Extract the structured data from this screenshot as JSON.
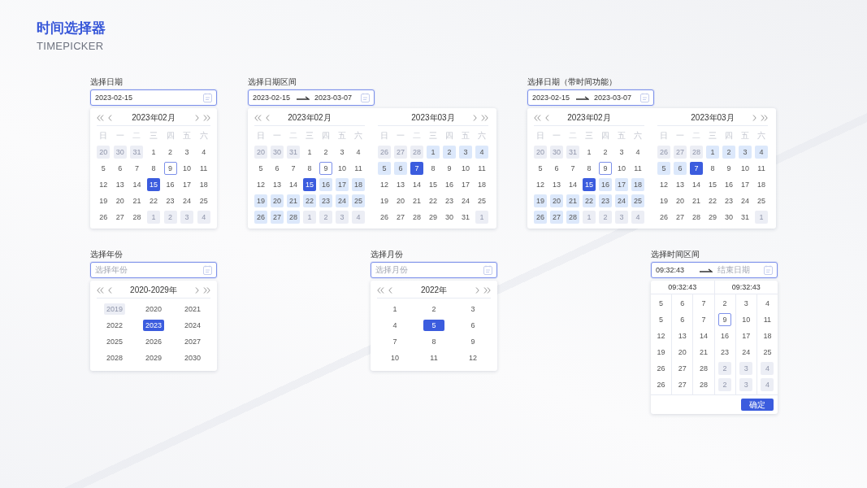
{
  "header": {
    "title": "时间选择器",
    "subtitle": "TIMEPICKER"
  },
  "pickers": [
    {
      "kind": "date",
      "label": "选择日期",
      "input": {
        "value": "2023-02-15"
      },
      "months": [
        {
          "title": "2023年02月",
          "weekdays": [
            "日",
            "一",
            "二",
            "三",
            "四",
            "五",
            "六"
          ],
          "days": [
            {
              "text": "20",
              "kind": "outside",
              "selected": false
            },
            {
              "text": "30",
              "kind": "outside",
              "selected": false
            },
            {
              "text": "31",
              "kind": "outside",
              "selected": false
            },
            {
              "text": "1",
              "kind": "day",
              "selected": false
            },
            {
              "text": "2",
              "kind": "day",
              "selected": false
            },
            {
              "text": "3",
              "kind": "day",
              "selected": false
            },
            {
              "text": "4",
              "kind": "day",
              "selected": false
            },
            {
              "text": "5",
              "kind": "day",
              "selected": false
            },
            {
              "text": "6",
              "kind": "day",
              "selected": false
            },
            {
              "text": "7",
              "kind": "day",
              "selected": false
            },
            {
              "text": "8",
              "kind": "day",
              "selected": false
            },
            {
              "text": "9",
              "kind": "today",
              "selected": false
            },
            {
              "text": "10",
              "kind": "day",
              "selected": false
            },
            {
              "text": "11",
              "kind": "day",
              "selected": false
            },
            {
              "text": "12",
              "kind": "day",
              "selected": false
            },
            {
              "text": "13",
              "kind": "day",
              "selected": false
            },
            {
              "text": "14",
              "kind": "day",
              "selected": false
            },
            {
              "text": "15",
              "kind": "day",
              "selected": true
            },
            {
              "text": "16",
              "kind": "day",
              "selected": false
            },
            {
              "text": "17",
              "kind": "day",
              "selected": false
            },
            {
              "text": "18",
              "kind": "day",
              "selected": false
            },
            {
              "text": "19",
              "kind": "day",
              "selected": false
            },
            {
              "text": "20",
              "kind": "day",
              "selected": false
            },
            {
              "text": "21",
              "kind": "day",
              "selected": false
            },
            {
              "text": "22",
              "kind": "day",
              "selected": false
            },
            {
              "text": "23",
              "kind": "day",
              "selected": false
            },
            {
              "text": "24",
              "kind": "day",
              "selected": false
            },
            {
              "text": "25",
              "kind": "day",
              "selected": false
            },
            {
              "text": "26",
              "kind": "day",
              "selected": false
            },
            {
              "text": "27",
              "kind": "day",
              "selected": false
            },
            {
              "text": "28",
              "kind": "day",
              "selected": false
            },
            {
              "text": "1",
              "kind": "outside",
              "selected": false
            },
            {
              "text": "2",
              "kind": "outside",
              "selected": false
            },
            {
              "text": "3",
              "kind": "outside",
              "selected": false
            },
            {
              "text": "4",
              "kind": "outside",
              "selected": false
            }
          ]
        }
      ]
    },
    {
      "kind": "date_range",
      "label": "选择日期区间",
      "input": {
        "start": "2023-02-15",
        "end": "2023-03-07"
      },
      "months": [
        {
          "title": "2023年02月",
          "weekdays": [
            "日",
            "一",
            "二",
            "三",
            "四",
            "五",
            "六"
          ],
          "days": [
            {
              "text": "20",
              "kind": "outside",
              "selected": false
            },
            {
              "text": "30",
              "kind": "outside",
              "selected": false
            },
            {
              "text": "31",
              "kind": "outside",
              "selected": false
            },
            {
              "text": "1",
              "kind": "day",
              "selected": false
            },
            {
              "text": "2",
              "kind": "day",
              "selected": false
            },
            {
              "text": "3",
              "kind": "day",
              "selected": false
            },
            {
              "text": "4",
              "kind": "day",
              "selected": false
            },
            {
              "text": "5",
              "kind": "day",
              "selected": false
            },
            {
              "text": "6",
              "kind": "day",
              "selected": false
            },
            {
              "text": "7",
              "kind": "day",
              "selected": false
            },
            {
              "text": "8",
              "kind": "day",
              "selected": false
            },
            {
              "text": "9",
              "kind": "today",
              "selected": false
            },
            {
              "text": "10",
              "kind": "day",
              "selected": false
            },
            {
              "text": "11",
              "kind": "day",
              "selected": false
            },
            {
              "text": "12",
              "kind": "day",
              "selected": false
            },
            {
              "text": "13",
              "kind": "day",
              "selected": false
            },
            {
              "text": "14",
              "kind": "day",
              "selected": false
            },
            {
              "text": "15",
              "kind": "day",
              "selected": true
            },
            {
              "text": "16",
              "kind": "range",
              "selected": false
            },
            {
              "text": "17",
              "kind": "range",
              "selected": false
            },
            {
              "text": "18",
              "kind": "range",
              "selected": false
            },
            {
              "text": "19",
              "kind": "range",
              "selected": false
            },
            {
              "text": "20",
              "kind": "range",
              "selected": false
            },
            {
              "text": "21",
              "kind": "range",
              "selected": false
            },
            {
              "text": "22",
              "kind": "range",
              "selected": false
            },
            {
              "text": "23",
              "kind": "range",
              "selected": false
            },
            {
              "text": "24",
              "kind": "range",
              "selected": false
            },
            {
              "text": "25",
              "kind": "range",
              "selected": false
            },
            {
              "text": "26",
              "kind": "range",
              "selected": false
            },
            {
              "text": "27",
              "kind": "range",
              "selected": false
            },
            {
              "text": "28",
              "kind": "range",
              "selected": false
            },
            {
              "text": "1",
              "kind": "outside",
              "selected": false
            },
            {
              "text": "2",
              "kind": "outside",
              "selected": false
            },
            {
              "text": "3",
              "kind": "outside",
              "selected": false
            },
            {
              "text": "4",
              "kind": "outside",
              "selected": false
            }
          ]
        },
        {
          "title": "2023年03月",
          "weekdays": [
            "日",
            "一",
            "二",
            "三",
            "四",
            "五",
            "六"
          ],
          "days": [
            {
              "text": "26",
              "kind": "outside",
              "selected": false
            },
            {
              "text": "27",
              "kind": "outside",
              "selected": false
            },
            {
              "text": "28",
              "kind": "outside",
              "selected": false
            },
            {
              "text": "1",
              "kind": "range",
              "selected": false
            },
            {
              "text": "2",
              "kind": "range",
              "selected": false
            },
            {
              "text": "3",
              "kind": "range",
              "selected": false
            },
            {
              "text": "4",
              "kind": "range",
              "selected": false
            },
            {
              "text": "5",
              "kind": "range",
              "selected": false
            },
            {
              "text": "6",
              "kind": "range",
              "selected": false
            },
            {
              "text": "7",
              "kind": "day",
              "selected": true
            },
            {
              "text": "8",
              "kind": "day",
              "selected": false
            },
            {
              "text": "9",
              "kind": "day",
              "selected": false
            },
            {
              "text": "10",
              "kind": "day",
              "selected": false
            },
            {
              "text": "11",
              "kind": "day",
              "selected": false
            },
            {
              "text": "12",
              "kind": "day",
              "selected": false
            },
            {
              "text": "13",
              "kind": "day",
              "selected": false
            },
            {
              "text": "14",
              "kind": "day",
              "selected": false
            },
            {
              "text": "15",
              "kind": "day",
              "selected": false
            },
            {
              "text": "16",
              "kind": "day",
              "selected": false
            },
            {
              "text": "17",
              "kind": "day",
              "selected": false
            },
            {
              "text": "18",
              "kind": "day",
              "selected": false
            },
            {
              "text": "19",
              "kind": "day",
              "selected": false
            },
            {
              "text": "20",
              "kind": "day",
              "selected": false
            },
            {
              "text": "21",
              "kind": "day",
              "selected": false
            },
            {
              "text": "22",
              "kind": "day",
              "selected": false
            },
            {
              "text": "23",
              "kind": "day",
              "selected": false
            },
            {
              "text": "24",
              "kind": "day",
              "selected": false
            },
            {
              "text": "25",
              "kind": "day",
              "selected": false
            },
            {
              "text": "26",
              "kind": "day",
              "selected": false
            },
            {
              "text": "27",
              "kind": "day",
              "selected": false
            },
            {
              "text": "28",
              "kind": "day",
              "selected": false
            },
            {
              "text": "29",
              "kind": "day",
              "selected": false
            },
            {
              "text": "30",
              "kind": "day",
              "selected": false
            },
            {
              "text": "31",
              "kind": "day",
              "selected": false
            },
            {
              "text": "1",
              "kind": "outside",
              "selected": false
            }
          ]
        }
      ]
    },
    {
      "kind": "date_range",
      "label": "选择日期（带时间功能）",
      "input": {
        "start": "2023-02-15",
        "end": "2023-03-07"
      },
      "months": [
        {
          "title": "2023年02月",
          "weekdays": [
            "日",
            "一",
            "二",
            "三",
            "四",
            "五",
            "六"
          ],
          "days": [
            {
              "text": "20",
              "kind": "outside",
              "selected": false
            },
            {
              "text": "30",
              "kind": "outside",
              "selected": false
            },
            {
              "text": "31",
              "kind": "outside",
              "selected": false
            },
            {
              "text": "1",
              "kind": "day",
              "selected": false
            },
            {
              "text": "2",
              "kind": "day",
              "selected": false
            },
            {
              "text": "3",
              "kind": "day",
              "selected": false
            },
            {
              "text": "4",
              "kind": "day",
              "selected": false
            },
            {
              "text": "5",
              "kind": "day",
              "selected": false
            },
            {
              "text": "6",
              "kind": "day",
              "selected": false
            },
            {
              "text": "7",
              "kind": "day",
              "selected": false
            },
            {
              "text": "8",
              "kind": "day",
              "selected": false
            },
            {
              "text": "9",
              "kind": "today",
              "selected": false
            },
            {
              "text": "10",
              "kind": "day",
              "selected": false
            },
            {
              "text": "11",
              "kind": "day",
              "selected": false
            },
            {
              "text": "12",
              "kind": "day",
              "selected": false
            },
            {
              "text": "13",
              "kind": "day",
              "selected": false
            },
            {
              "text": "14",
              "kind": "day",
              "selected": false
            },
            {
              "text": "15",
              "kind": "day",
              "selected": true
            },
            {
              "text": "16",
              "kind": "range",
              "selected": false
            },
            {
              "text": "17",
              "kind": "range",
              "selected": false
            },
            {
              "text": "18",
              "kind": "range",
              "selected": false
            },
            {
              "text": "19",
              "kind": "range",
              "selected": false
            },
            {
              "text": "20",
              "kind": "range",
              "selected": false
            },
            {
              "text": "21",
              "kind": "range",
              "selected": false
            },
            {
              "text": "22",
              "kind": "range",
              "selected": false
            },
            {
              "text": "23",
              "kind": "range",
              "selected": false
            },
            {
              "text": "24",
              "kind": "range",
              "selected": false
            },
            {
              "text": "25",
              "kind": "range",
              "selected": false
            },
            {
              "text": "26",
              "kind": "range",
              "selected": false
            },
            {
              "text": "27",
              "kind": "range",
              "selected": false
            },
            {
              "text": "28",
              "kind": "range",
              "selected": false
            },
            {
              "text": "1",
              "kind": "outside",
              "selected": false
            },
            {
              "text": "2",
              "kind": "outside",
              "selected": false
            },
            {
              "text": "3",
              "kind": "outside",
              "selected": false
            },
            {
              "text": "4",
              "kind": "outside",
              "selected": false
            }
          ]
        },
        {
          "title": "2023年03月",
          "weekdays": [
            "日",
            "一",
            "二",
            "三",
            "四",
            "五",
            "六"
          ],
          "days": [
            {
              "text": "26",
              "kind": "outside",
              "selected": false
            },
            {
              "text": "27",
              "kind": "outside",
              "selected": false
            },
            {
              "text": "28",
              "kind": "outside",
              "selected": false
            },
            {
              "text": "1",
              "kind": "range",
              "selected": false
            },
            {
              "text": "2",
              "kind": "range",
              "selected": false
            },
            {
              "text": "3",
              "kind": "range",
              "selected": false
            },
            {
              "text": "4",
              "kind": "range",
              "selected": false
            },
            {
              "text": "5",
              "kind": "range",
              "selected": false
            },
            {
              "text": "6",
              "kind": "range",
              "selected": false
            },
            {
              "text": "7",
              "kind": "day",
              "selected": true
            },
            {
              "text": "8",
              "kind": "day",
              "selected": false
            },
            {
              "text": "9",
              "kind": "day",
              "selected": false
            },
            {
              "text": "10",
              "kind": "day",
              "selected": false
            },
            {
              "text": "11",
              "kind": "day",
              "selected": false
            },
            {
              "text": "12",
              "kind": "day",
              "selected": false
            },
            {
              "text": "13",
              "kind": "day",
              "selected": false
            },
            {
              "text": "14",
              "kind": "day",
              "selected": false
            },
            {
              "text": "15",
              "kind": "day",
              "selected": false
            },
            {
              "text": "16",
              "kind": "day",
              "selected": false
            },
            {
              "text": "17",
              "kind": "day",
              "selected": false
            },
            {
              "text": "18",
              "kind": "day",
              "selected": false
            },
            {
              "text": "19",
              "kind": "day",
              "selected": false
            },
            {
              "text": "20",
              "kind": "day",
              "selected": false
            },
            {
              "text": "21",
              "kind": "day",
              "selected": false
            },
            {
              "text": "22",
              "kind": "day",
              "selected": false
            },
            {
              "text": "23",
              "kind": "day",
              "selected": false
            },
            {
              "text": "24",
              "kind": "day",
              "selected": false
            },
            {
              "text": "25",
              "kind": "day",
              "selected": false
            },
            {
              "text": "26",
              "kind": "day",
              "selected": false
            },
            {
              "text": "27",
              "kind": "day",
              "selected": false
            },
            {
              "text": "28",
              "kind": "day",
              "selected": false
            },
            {
              "text": "29",
              "kind": "day",
              "selected": false
            },
            {
              "text": "30",
              "kind": "day",
              "selected": false
            },
            {
              "text": "31",
              "kind": "day",
              "selected": false
            },
            {
              "text": "1",
              "kind": "outside",
              "selected": false
            }
          ]
        }
      ]
    },
    {
      "kind": "year",
      "label": "选择年份",
      "input": {
        "placeholder": "选择年份"
      },
      "title": "2020-2029年",
      "items": [
        {
          "text": "2019",
          "kind": "outside",
          "selected": false
        },
        {
          "text": "2020",
          "kind": "day",
          "selected": false
        },
        {
          "text": "2021",
          "kind": "day",
          "selected": false
        },
        {
          "text": "2022",
          "kind": "day",
          "selected": false
        },
        {
          "text": "2023",
          "kind": "day",
          "selected": true
        },
        {
          "text": "2024",
          "kind": "day",
          "selected": false
        },
        {
          "text": "2025",
          "kind": "day",
          "selected": false
        },
        {
          "text": "2026",
          "kind": "day",
          "selected": false
        },
        {
          "text": "2027",
          "kind": "day",
          "selected": false
        },
        {
          "text": "2028",
          "kind": "day",
          "selected": false
        },
        {
          "text": "2029",
          "kind": "day",
          "selected": false
        },
        {
          "text": "2030",
          "kind": "day",
          "selected": false
        }
      ]
    },
    {
      "kind": "month",
      "label": "选择月份",
      "input": {
        "placeholder": "选择月份"
      },
      "title": "2022年",
      "items": [
        {
          "text": "1",
          "kind": "day",
          "selected": false
        },
        {
          "text": "2",
          "kind": "day",
          "selected": false
        },
        {
          "text": "3",
          "kind": "day",
          "selected": false
        },
        {
          "text": "4",
          "kind": "day",
          "selected": false
        },
        {
          "text": "5",
          "kind": "day",
          "selected": true
        },
        {
          "text": "6",
          "kind": "day",
          "selected": false
        },
        {
          "text": "7",
          "kind": "day",
          "selected": false
        },
        {
          "text": "8",
          "kind": "day",
          "selected": false
        },
        {
          "text": "9",
          "kind": "day",
          "selected": false
        },
        {
          "text": "10",
          "kind": "day",
          "selected": false
        },
        {
          "text": "11",
          "kind": "day",
          "selected": false
        },
        {
          "text": "12",
          "kind": "day",
          "selected": false
        }
      ]
    },
    {
      "kind": "time_range",
      "label": "选择时间区间",
      "input": {
        "start": "09:32:43",
        "end_placeholder": "结束日期"
      },
      "times": [
        "09:32:43",
        "09:32:43"
      ],
      "columns": [
        [
          {
            "text": "5",
            "kind": "day"
          },
          {
            "text": "5",
            "kind": "day"
          },
          {
            "text": "12",
            "kind": "day"
          },
          {
            "text": "19",
            "kind": "day"
          },
          {
            "text": "26",
            "kind": "day"
          },
          {
            "text": "26",
            "kind": "day"
          }
        ],
        [
          {
            "text": "6",
            "kind": "day"
          },
          {
            "text": "6",
            "kind": "day"
          },
          {
            "text": "13",
            "kind": "day"
          },
          {
            "text": "20",
            "kind": "day"
          },
          {
            "text": "27",
            "kind": "day"
          },
          {
            "text": "27",
            "kind": "day"
          }
        ],
        [
          {
            "text": "7",
            "kind": "day"
          },
          {
            "text": "7",
            "kind": "day"
          },
          {
            "text": "14",
            "kind": "day"
          },
          {
            "text": "21",
            "kind": "day"
          },
          {
            "text": "28",
            "kind": "day"
          },
          {
            "text": "28",
            "kind": "day"
          }
        ],
        [
          {
            "text": "2",
            "kind": "day"
          },
          {
            "text": "9",
            "kind": "today"
          },
          {
            "text": "16",
            "kind": "day"
          },
          {
            "text": "23",
            "kind": "day"
          },
          {
            "text": "2",
            "kind": "outside"
          },
          {
            "text": "2",
            "kind": "outside"
          }
        ],
        [
          {
            "text": "3",
            "kind": "day"
          },
          {
            "text": "10",
            "kind": "day"
          },
          {
            "text": "17",
            "kind": "day"
          },
          {
            "text": "24",
            "kind": "day"
          },
          {
            "text": "3",
            "kind": "outside"
          },
          {
            "text": "3",
            "kind": "outside"
          }
        ],
        [
          {
            "text": "4",
            "kind": "day"
          },
          {
            "text": "11",
            "kind": "day"
          },
          {
            "text": "18",
            "kind": "day"
          },
          {
            "text": "25",
            "kind": "day"
          },
          {
            "text": "4",
            "kind": "outside"
          },
          {
            "text": "4",
            "kind": "outside"
          }
        ]
      ],
      "confirm": "确定"
    }
  ]
}
